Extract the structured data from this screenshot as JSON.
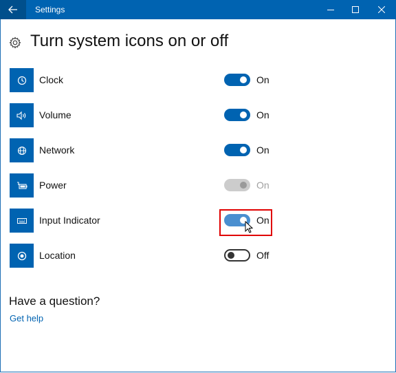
{
  "window": {
    "title": "Settings",
    "controls": [
      "minimize",
      "maximize",
      "close"
    ]
  },
  "page": {
    "title": "Turn system icons on or off",
    "icon": "gear-icon"
  },
  "items": [
    {
      "label": "Clock",
      "icon": "clock-icon",
      "state": "On",
      "enabled": true
    },
    {
      "label": "Volume",
      "icon": "volume-icon",
      "state": "On",
      "enabled": true
    },
    {
      "label": "Network",
      "icon": "network-icon",
      "state": "On",
      "enabled": true
    },
    {
      "label": "Power",
      "icon": "power-icon",
      "state": "On",
      "enabled": false
    },
    {
      "label": "Input Indicator",
      "icon": "keyboard-icon",
      "state": "On",
      "enabled": true,
      "hovered": true
    },
    {
      "label": "Location",
      "icon": "location-icon",
      "state": "Off",
      "enabled": true
    }
  ],
  "help": {
    "heading": "Have a question?",
    "link": "Get help"
  },
  "colors": {
    "accent": "#0063b1",
    "highlight_box": "#e00000"
  }
}
